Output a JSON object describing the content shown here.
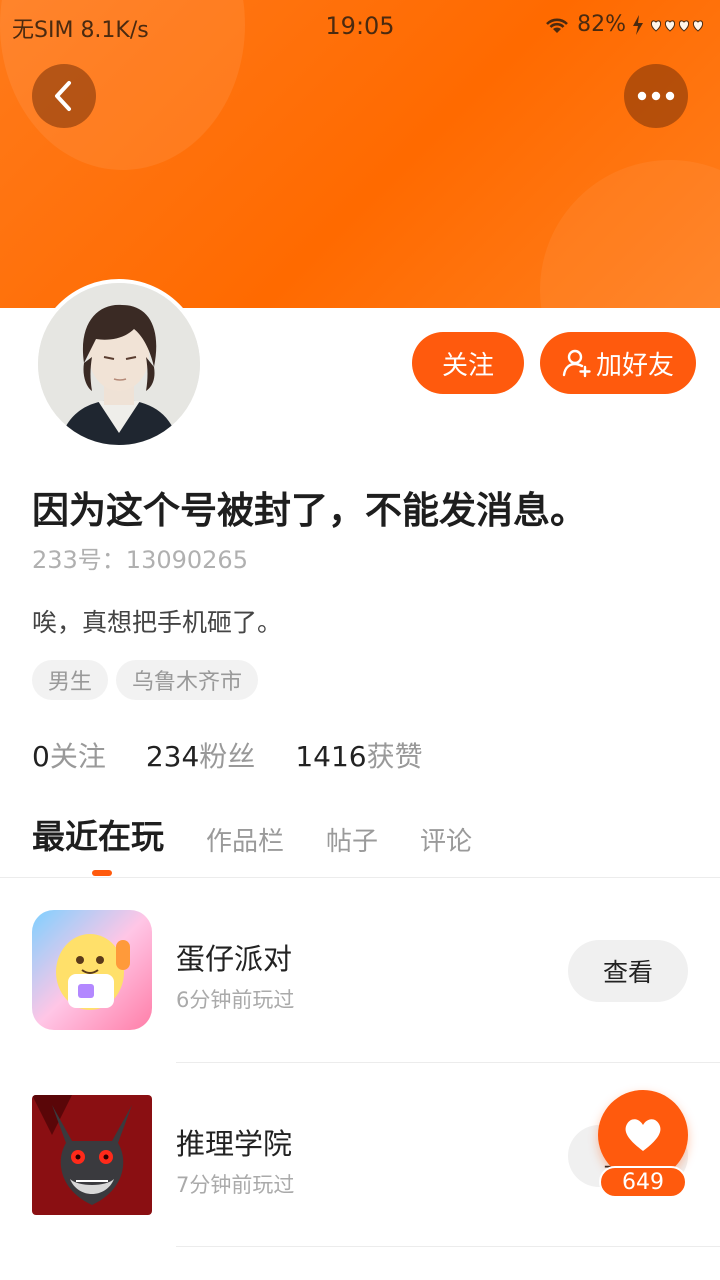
{
  "status_bar": {
    "carrier": "无SIM",
    "speed": "8.1K/s",
    "time": "19:05",
    "battery": "82%"
  },
  "header": {
    "back_icon": "chevron-left-icon",
    "more_icon": "more-dots-icon"
  },
  "profile": {
    "follow_label": "关注",
    "add_friend_label": "加好友",
    "username": "因为这个号被封了，不能发消息。",
    "uid": "233号：13090265",
    "bio": "唉，真想把手机砸了。",
    "tags": [
      "男生",
      "乌鲁木齐市"
    ],
    "stats": [
      {
        "num": "0",
        "label": "关注"
      },
      {
        "num": "234",
        "label": "粉丝"
      },
      {
        "num": "1416",
        "label": "获赞"
      }
    ]
  },
  "tabs": [
    {
      "label": "最近在玩",
      "active": true
    },
    {
      "label": "作品栏",
      "active": false
    },
    {
      "label": "帖子",
      "active": false
    },
    {
      "label": "评论",
      "active": false
    }
  ],
  "games": [
    {
      "name": "蛋仔派对",
      "time": "6分钟前玩过",
      "action": "查看"
    },
    {
      "name": "推理学院",
      "time": "7分钟前玩过",
      "action": "查看"
    }
  ],
  "like_fab": {
    "count": "649"
  },
  "colors": {
    "accent": "#ff5a0d",
    "header": "#ff6a00"
  }
}
